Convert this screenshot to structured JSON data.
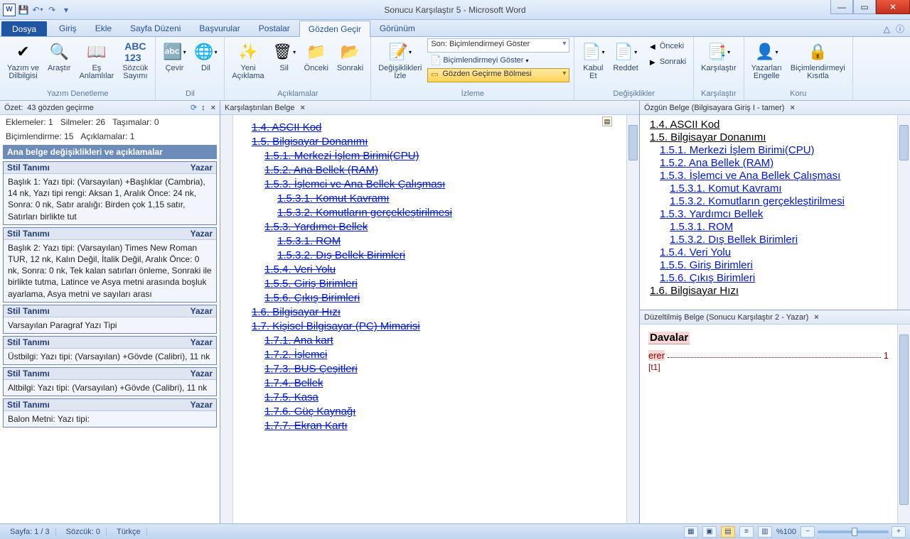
{
  "titlebar": {
    "title": "Sonucu Karşılaştır 5  -  Microsoft Word"
  },
  "tabs": {
    "file": "Dosya",
    "items": [
      "Giriş",
      "Ekle",
      "Sayfa Düzeni",
      "Başvurular",
      "Postalar",
      "Gözden Geçir",
      "Görünüm"
    ],
    "active": "Gözden Geçir"
  },
  "ribbon": {
    "proofing": {
      "label": "Yazım Denetleme",
      "spell": "Yazım ve\nDilbilgisi",
      "research": "Araştır",
      "thesaurus": "Eş\nAnlamlılar",
      "wordcount": "Sözcük\nSayımı"
    },
    "language": {
      "label": "Dil",
      "translate": "Çevir",
      "language": "Dil"
    },
    "comments": {
      "label": "Açıklamalar",
      "new": "Yeni\nAçıklama",
      "delete": "Sil",
      "prev": "Önceki",
      "next": "Sonraki"
    },
    "tracking": {
      "label": "İzleme",
      "track": "Değişiklikleri\nİzle",
      "display": "Son: Biçimlendirmeyi Göster",
      "showmarkup": "Biçimlendirmeyi Göster",
      "pane": "Gözden Geçirme Bölmesi"
    },
    "changes": {
      "label": "Değişiklikler",
      "accept": "Kabul\nEt",
      "reject": "Reddet",
      "prev": "Önceki",
      "next": "Sonraki"
    },
    "compare": {
      "label": "Karşılaştır",
      "compare": "Karşılaştır"
    },
    "protect": {
      "label": "Koru",
      "authors": "Yazarları\nEngelle",
      "restrict": "Biçimlendirmeyi\nKısıtla"
    }
  },
  "left": {
    "headerPrefix": "Özet:",
    "headerText": "43 gözden geçirme",
    "ins_label": "Eklemeler:",
    "ins_val": "1",
    "del_label": "Silmeler:",
    "del_val": "26",
    "mov_label": "Taşımalar:",
    "mov_val": "0",
    "fmt_label": "Biçimlendirme:",
    "fmt_val": "15",
    "com_label": "Açıklamalar:",
    "com_val": "1",
    "section": "Ana belge değişiklikleri ve açıklamalar",
    "styleLabel": "Stil Tanımı",
    "author": "Yazar",
    "items": [
      "Başlık 1: Yazı tipi: (Varsayılan) +Başlıklar (Cambria), 14 nk, Yazı tipi rengi: Aksan 1, Aralık Önce:  24 nk, Sonra:  0 nk, Satır aralığı:  Birden çok 1,15 satır, Satırları birlikte tut",
      "Başlık 2: Yazı tipi: (Varsayılan) Times New Roman TUR, 12 nk, Kalın Değil, İtalik Değil, Aralık Önce:  0 nk, Sonra:  0 nk, Tek kalan satırları önleme, Sonraki ile birlikte tutma, Latince ve Asya metni arasında boşluk ayarlama, Asya metni ve sayıları arası",
      "Varsayılan Paragraf Yazı Tipi",
      "Üstbilgi: Yazı tipi: (Varsayılan) +Gövde (Calibri), 11 nk",
      "Altbilgi: Yazı tipi: (Varsayılan) +Gövde (Calibri), 11 nk",
      "Balon Metni: Yazı tipi:"
    ]
  },
  "center": {
    "header": "Karşılaştırılan Belge",
    "toc": [
      {
        "t": "1.4. ASCII Kod",
        "i": 0
      },
      {
        "t": "1.5. Bilgisayar Donanımı",
        "i": 0
      },
      {
        "t": "1.5.1. Merkezi İşlem Birimi(CPU)",
        "i": 1
      },
      {
        "t": "1.5.2. Ana Bellek (RAM)",
        "i": 1
      },
      {
        "t": "1.5.3. İşlemci ve Ana Bellek Çalışması",
        "i": 1
      },
      {
        "t": "1.5.3.1. Komut Kavramı",
        "i": 2
      },
      {
        "t": "1.5.3.2. Komutların gerçekleştirilmesi",
        "i": 2
      },
      {
        "t": "1.5.3. Yardımcı Bellek",
        "i": 1
      },
      {
        "t": "1.5.3.1. ROM",
        "i": 2
      },
      {
        "t": "1.5.3.2. Dış Bellek Birimleri",
        "i": 2
      },
      {
        "t": "1.5.4. Veri Yolu",
        "i": 1
      },
      {
        "t": "1.5.5. Giriş Birimleri",
        "i": 1
      },
      {
        "t": "1.5.6. Çıkış Birimleri",
        "i": 1
      },
      {
        "t": "1.6. Bilgisayar Hızı",
        "i": 0
      },
      {
        "t": "1.7. Kişisel Bilgisayar (PC) Mimarisi",
        "i": 0
      },
      {
        "t": "1.7.1. Ana kart",
        "i": 1
      },
      {
        "t": "1.7.2. İşlemci",
        "i": 1
      },
      {
        "t": "1.7.3. BUS Çeşitleri",
        "i": 1
      },
      {
        "t": "1.7.4. Bellek",
        "i": 1
      },
      {
        "t": "1.7.5. Kasa",
        "i": 1
      },
      {
        "t": "1.7.6. Güç Kaynağı",
        "i": 1
      },
      {
        "t": "1.7.7. Ekran Kartı",
        "i": 1
      }
    ]
  },
  "rightTop": {
    "header": "Özgün Belge (Bilgisayara Giriş I - tamer)",
    "toc": [
      {
        "t": "1.4. ASCII Kod",
        "i": 0,
        "c": "black"
      },
      {
        "t": "1.5. Bilgisayar Donanımı",
        "i": 0,
        "c": "black"
      },
      {
        "t": "1.5.1. Merkezi İşlem Birimi(CPU)",
        "i": 1
      },
      {
        "t": "1.5.2. Ana Bellek (RAM)",
        "i": 1
      },
      {
        "t": "1.5.3. İşlemci ve Ana Bellek Çalışması",
        "i": 1
      },
      {
        "t": "1.5.3.1. Komut Kavramı",
        "i": 2
      },
      {
        "t": "1.5.3.2. Komutların gerçekleştirilmesi",
        "i": 2
      },
      {
        "t": "1.5.3. Yardımcı Bellek",
        "i": 1
      },
      {
        "t": "1.5.3.1. ROM",
        "i": 2
      },
      {
        "t": "1.5.3.2. Dış Bellek Birimleri",
        "i": 2
      },
      {
        "t": "1.5.4. Veri Yolu",
        "i": 1
      },
      {
        "t": "1.5.5. Giriş Birimleri",
        "i": 1
      },
      {
        "t": "1.5.6. Çıkış Birimleri",
        "i": 1
      },
      {
        "t": "1.6. Bilgisayar Hızı",
        "i": 0,
        "c": "black"
      }
    ]
  },
  "rightBot": {
    "header": "Düzeltilmiş Belge (Sonucu Karşılaştır 2 - Yazar)",
    "title": "Davalar",
    "entry_lead": "erer",
    "entry_page": "1",
    "marker": "[t1]"
  },
  "status": {
    "page": "Sayfa: 1 / 3",
    "words": "Sözcük: 0",
    "lang": "Türkçe",
    "zoom": "%100"
  }
}
